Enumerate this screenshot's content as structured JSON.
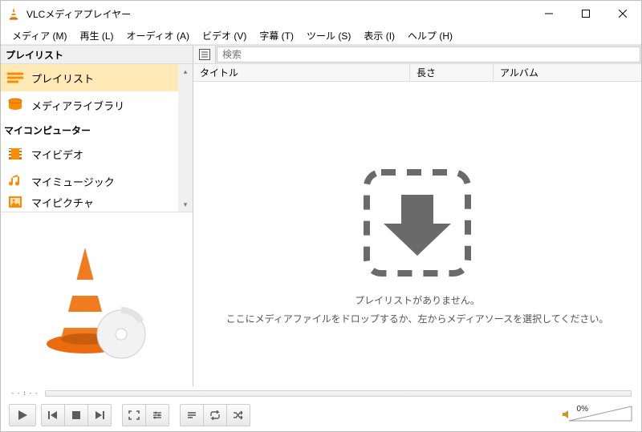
{
  "window": {
    "title": "VLCメディアプレイヤー"
  },
  "menubar": {
    "items": [
      "メディア (M)",
      "再生 (L)",
      "オーディオ (A)",
      "ビデオ (V)",
      "字幕 (T)",
      "ツール (S)",
      "表示 (I)",
      "ヘルプ (H)"
    ]
  },
  "topbar": {
    "playlist_heading": "プレイリスト",
    "search_placeholder": "検索"
  },
  "sidebar": {
    "heading": "プレイリスト",
    "items": [
      {
        "label": "プレイリスト",
        "icon": "playlist",
        "selected": true
      },
      {
        "label": "メディアライブラリ",
        "icon": "library",
        "selected": false
      }
    ],
    "group_header": "マイコンピューター",
    "group_items": [
      {
        "label": "マイビデオ",
        "icon": "video"
      },
      {
        "label": "マイミュージック",
        "icon": "music"
      },
      {
        "label": "マイピクチャ",
        "icon": "picture"
      }
    ]
  },
  "columns": {
    "title": "タイトル",
    "duration": "長さ",
    "album": "アルバム"
  },
  "dropzone": {
    "msg1": "プレイリストがありません。",
    "msg2": "ここにメディアファイルをドロップするか、左からメディアソースを選択してください。"
  },
  "seek": {
    "time_label": "--:--"
  },
  "volume": {
    "label": "0%"
  },
  "icons": {
    "list_toggle": "list-toggle-icon"
  }
}
